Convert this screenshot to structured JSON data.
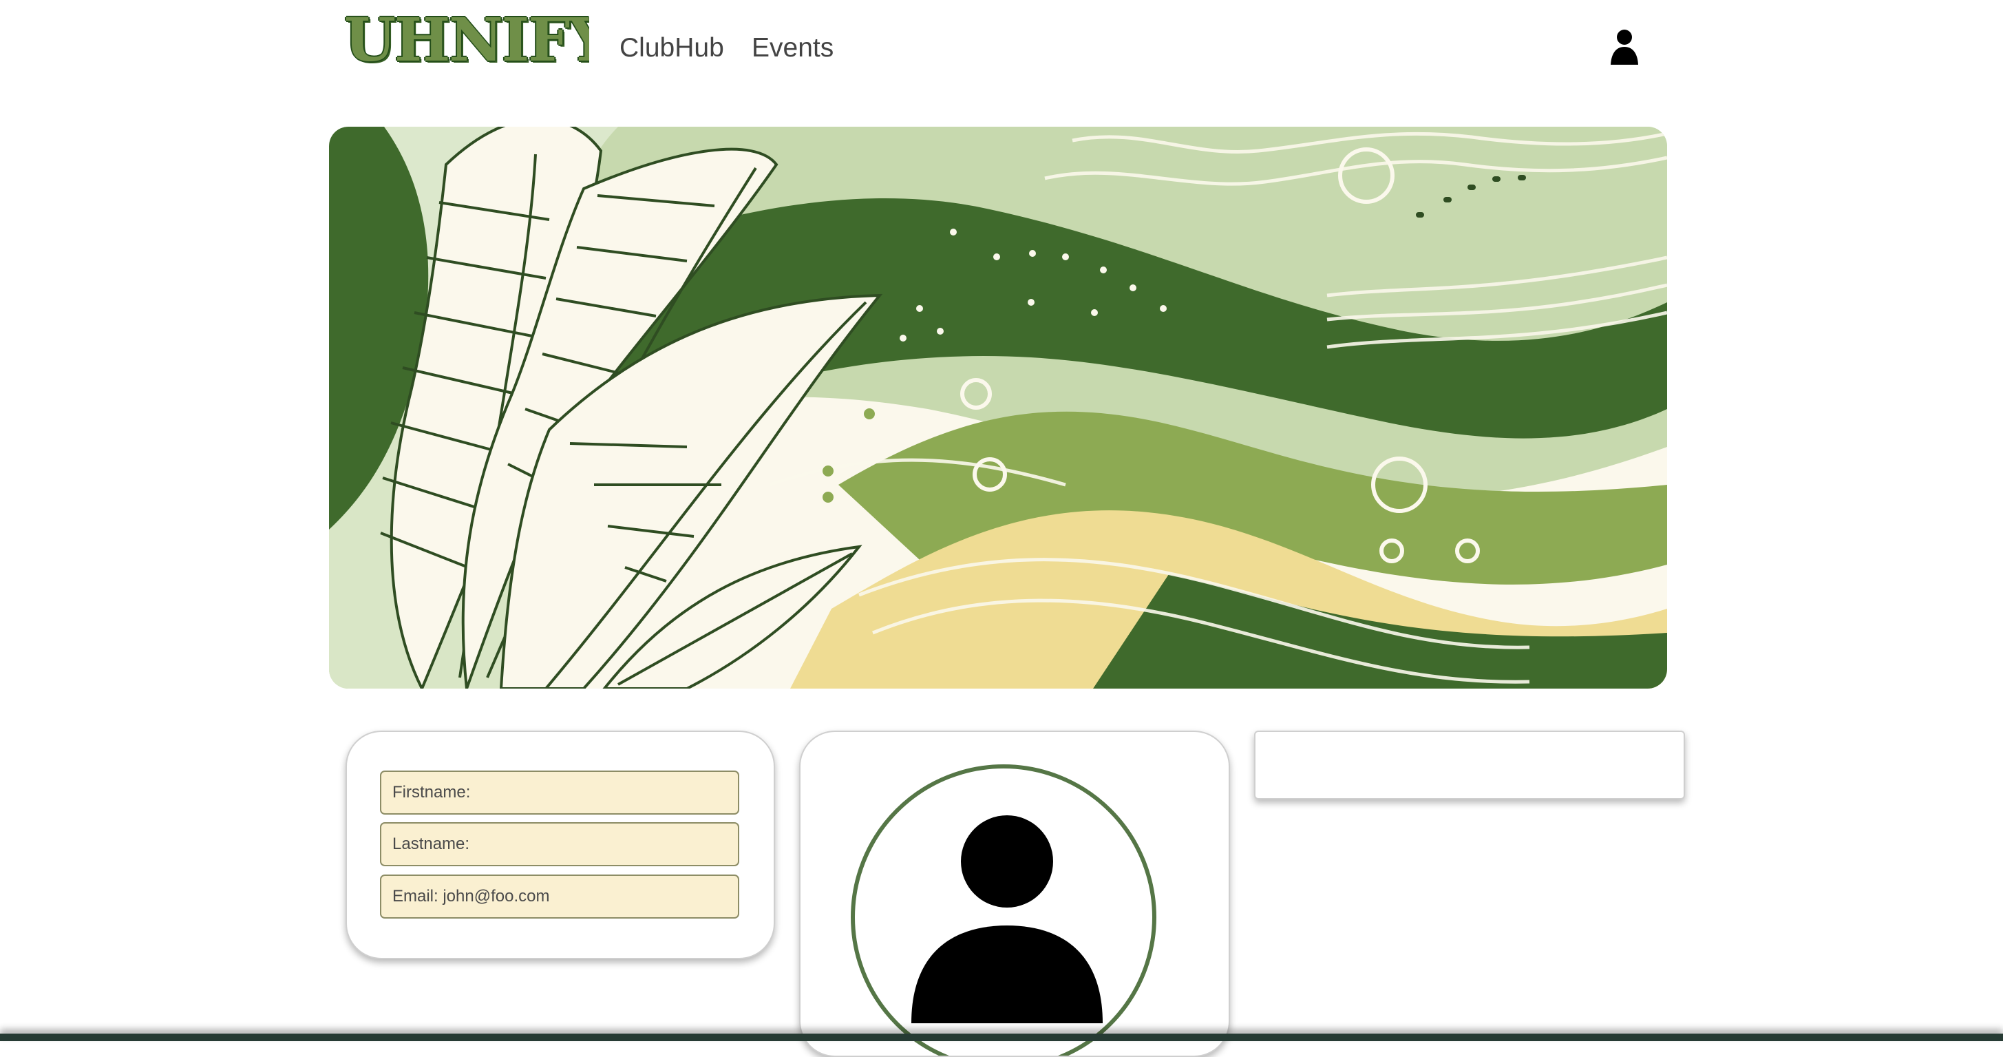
{
  "header": {
    "logo_text": "UHNIFY",
    "nav": [
      {
        "label": "ClubHub"
      },
      {
        "label": "Events"
      }
    ],
    "profile_icon": "user-icon"
  },
  "hero": {
    "image": "abstract-green-leaf-banner",
    "colors": {
      "sage": "#c7d9ae",
      "dark_green": "#3f6a2c",
      "olive": "#8daa53",
      "cream": "#fbf8ec",
      "yellow": "#efdc93"
    }
  },
  "profile_form": {
    "fields": [
      {
        "placeholder": "Firstname:",
        "value": ""
      },
      {
        "placeholder": "Lastname:",
        "value": ""
      },
      {
        "placeholder": "Email: john@foo.com",
        "value": ""
      }
    ],
    "field_background": "#faf0d1"
  },
  "avatar": {
    "icon": "user-avatar-icon",
    "ring_color": "#557646"
  },
  "info_panel": {
    "content": ""
  }
}
